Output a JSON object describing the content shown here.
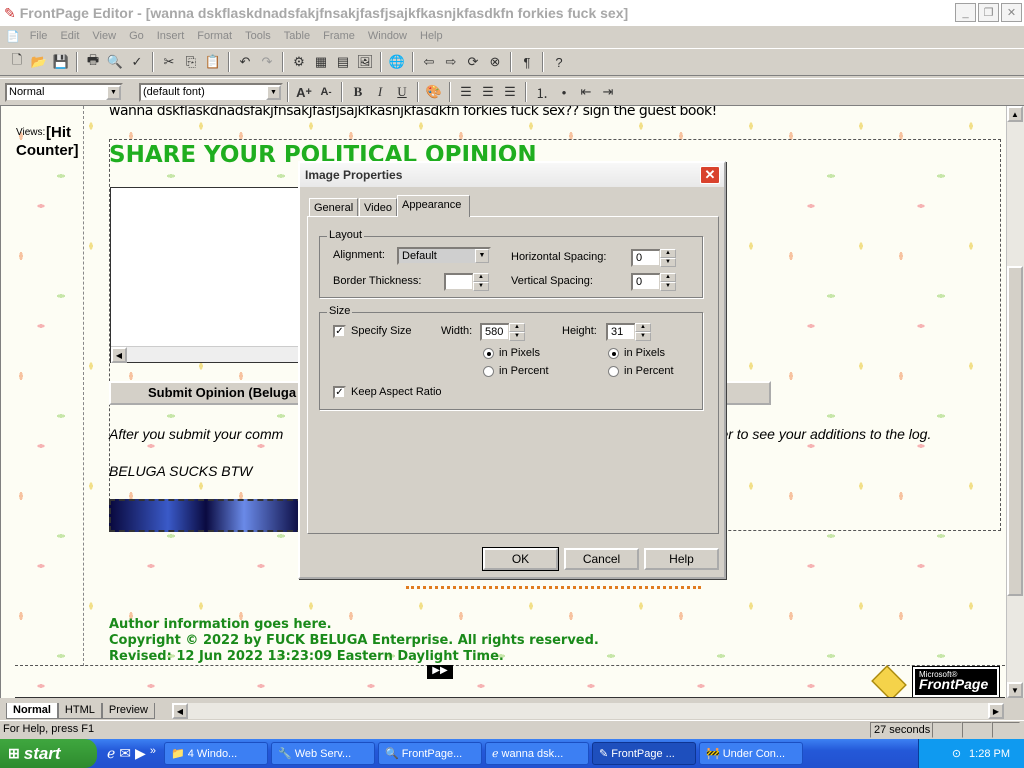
{
  "window": {
    "title": "FrontPage Editor - [wanna dskflaskdnadsfakjfnsakjfasfjsajkfkasnjkfasdkfn forkies fuck sex]"
  },
  "menu": [
    "File",
    "Edit",
    "View",
    "Go",
    "Insert",
    "Format",
    "Tools",
    "Table",
    "Frame",
    "Window",
    "Help"
  ],
  "format_bar": {
    "style": "Normal",
    "font": "(default font)"
  },
  "page": {
    "views_label": "Views:",
    "hit_counter": "[Hit Counter]",
    "top_line": "wanna dskflaskdnadsfakjfnsakjfasfjsajkfkasnjkfasdkfn forkies fuck sex?? sign the guest book!",
    "heading": "SHARE YOUR POLITICAL OPINION",
    "submit_label": "Submit Opinion (Beluga",
    "after_text_left": "After you submit your comm",
    "after_text_right": "rder to see your additions to the log.",
    "beluga": "BELUGA SUCKS BTW",
    "author": "Author information goes here.",
    "copyright": "Copyright © 2022 by FUCK BELUGA Enterprise. All rights reserved.",
    "revised": "Revised: 12 Jun 2022 13:23:09 Eastern Daylight Time.",
    "fp_logo_small": "Microsoft®",
    "fp_logo": "FrontPage"
  },
  "dialog": {
    "title": "Image Properties",
    "tabs": [
      "General",
      "Video",
      "Appearance"
    ],
    "layout": {
      "group": "Layout",
      "alignment_label": "Alignment:",
      "alignment_value": "Default",
      "border_label": "Border Thickness:",
      "border_value": "",
      "hspace_label": "Horizontal Spacing:",
      "hspace_value": "0",
      "vspace_label": "Vertical Spacing:",
      "vspace_value": "0"
    },
    "size": {
      "group": "Size",
      "specify_label": "Specify Size",
      "width_label": "Width:",
      "width_value": "580",
      "height_label": "Height:",
      "height_value": "31",
      "in_pixels": "in Pixels",
      "in_percent": "in Percent",
      "keep_aspect": "Keep Aspect Ratio"
    },
    "buttons": {
      "ok": "OK",
      "cancel": "Cancel",
      "help": "Help"
    }
  },
  "view_tabs": [
    "Normal",
    "HTML",
    "Preview"
  ],
  "status": {
    "help": "For Help, press F1",
    "time": "27 seconds"
  },
  "taskbar": {
    "start": "start",
    "tasks": [
      "4 Windo...",
      "Web Serv...",
      "FrontPage...",
      "wanna dsk...",
      "FrontPage ...",
      "Under Con..."
    ],
    "clock": "1:28 PM"
  }
}
